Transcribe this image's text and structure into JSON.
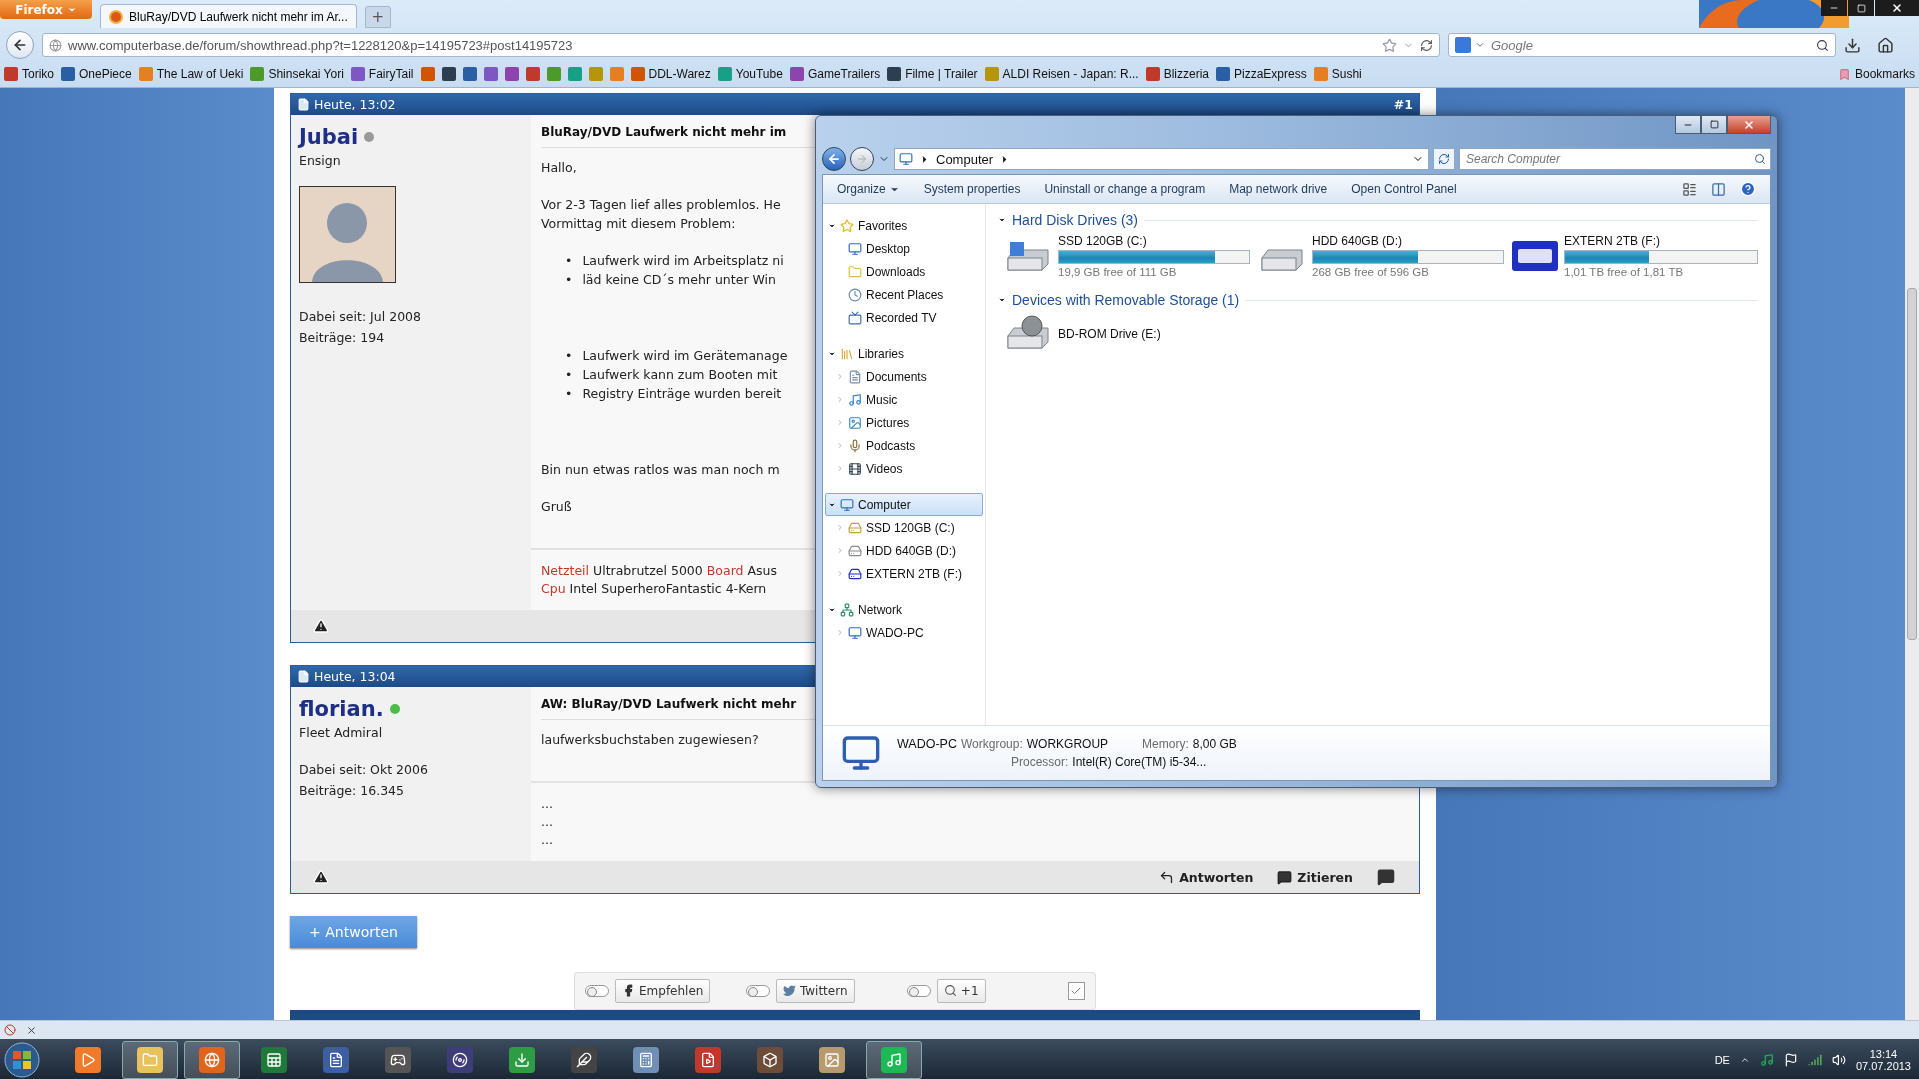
{
  "browser": {
    "menu_button": "Firefox",
    "tabs": [
      {
        "title": "BluRay/DVD Laufwerk nicht mehr im Ar...",
        "selected": true
      }
    ],
    "new_tab": "+",
    "url": "www.computerbase.de/forum/showthread.php?t=1228120&p=14195723#post14195723",
    "search_placeholder": "Google",
    "bookmarks": [
      {
        "kind": "link",
        "label": "Toriko"
      },
      {
        "kind": "link",
        "label": "OnePiece"
      },
      {
        "kind": "link",
        "label": "The Law of Ueki"
      },
      {
        "kind": "link",
        "label": "Shinsekai Yori"
      },
      {
        "kind": "link",
        "label": "FairyTail"
      },
      {
        "kind": "icon"
      },
      {
        "kind": "icon"
      },
      {
        "kind": "icon"
      },
      {
        "kind": "icon"
      },
      {
        "kind": "icon"
      },
      {
        "kind": "icon"
      },
      {
        "kind": "icon"
      },
      {
        "kind": "icon"
      },
      {
        "kind": "icon"
      },
      {
        "kind": "icon"
      },
      {
        "kind": "link",
        "label": "DDL-Warez"
      },
      {
        "kind": "link",
        "label": "YouTube"
      },
      {
        "kind": "link",
        "label": "GameTrailers"
      },
      {
        "kind": "link",
        "label": "Filme | Trailer"
      },
      {
        "kind": "link",
        "label": "ALDI Reisen - Japan: R..."
      },
      {
        "kind": "link",
        "label": "Blizzeria"
      },
      {
        "kind": "link",
        "label": "PizzaExpress"
      },
      {
        "kind": "link",
        "label": "Sushi"
      }
    ],
    "bookmarks_menu": "Bookmarks"
  },
  "posts": [
    {
      "date": "Heute, 13:02",
      "number": "#1",
      "user": "Jubai",
      "online": false,
      "rank": "Ensign",
      "avatar": true,
      "joined": "Dabei seit: Jul 2008",
      "count": "Beiträge: 194",
      "title": "BluRay/DVD Laufwerk nicht mehr im",
      "body": [
        {
          "kind": "paragraph",
          "lines": [
            "Hallo,"
          ]
        },
        {
          "kind": "paragraph",
          "lines": [
            "Vor 2-3 Tagen lief alles problemlos. He",
            "Vormittag mit diesem Problem:"
          ]
        },
        {
          "kind": "list",
          "marker": "•",
          "lines": [
            "Laufwerk wird im Arbeitsplatz ni",
            "läd keine CD´s mehr unter Win"
          ]
        },
        {
          "kind": "list",
          "marker": "•",
          "lines": [
            "Laufwerk wird im Gerätemanage",
            "Laufwerk kann zum Booten mit",
            "Registry Einträge wurden bereit"
          ]
        },
        {
          "kind": "paragraph",
          "lines": [
            "Bin nun etwas ratlos was man noch m"
          ]
        },
        {
          "kind": "paragraph",
          "lines": [
            "Gruß"
          ]
        }
      ],
      "signature": [
        [
          {
            "text": "Netzteil",
            "label": true
          },
          {
            "text": "Ultrabrutzel 5000",
            "label": false
          },
          {
            "text": "Board",
            "label": true
          },
          {
            "text": "Asus",
            "label": false
          }
        ],
        [
          {
            "text": "Cpu",
            "label": true
          },
          {
            "text": "Intel SuperheroFantastic 4-Kern",
            "label": false
          }
        ]
      ]
    },
    {
      "date": "Heute, 13:04",
      "user": "florian.",
      "online": true,
      "rank": "Fleet Admiral",
      "avatar": false,
      "joined": "Dabei seit: Okt 2006",
      "count": "Beiträge: 16.345",
      "title": "AW: BluRay/DVD Laufwerk nicht mehr",
      "body": [
        {
          "kind": "paragraph",
          "lines": [
            "laufwerksbuchstaben zugewiesen?"
          ]
        }
      ],
      "signature": [
        [
          {
            "text": "...",
            "label": false
          }
        ],
        [
          {
            "text": "...",
            "label": false
          }
        ],
        [
          {
            "text": "...",
            "label": false
          }
        ]
      ],
      "actions": [
        "Antworten",
        "Zitieren"
      ]
    }
  ],
  "reply_button": "+ Antworten",
  "share_settings": {
    "checked": true
  },
  "social": [
    {
      "label": "Empfehlen",
      "kind": "facebook",
      "on": false
    },
    {
      "label": "Twittern",
      "kind": "twitter",
      "on": false
    },
    {
      "label": "+1",
      "kind": "google",
      "on": false
    }
  ],
  "explorer": {
    "address": "Computer",
    "search_placeholder": "Search Computer",
    "commands": [
      {
        "label": "Organize",
        "menu": true
      },
      {
        "label": "System properties",
        "menu": false
      },
      {
        "label": "Uninstall or change a program",
        "menu": false
      },
      {
        "label": "Map network drive",
        "menu": false
      },
      {
        "label": "Open Control Panel",
        "menu": false
      }
    ],
    "tree": [
      {
        "label": "Favorites",
        "kind": "star",
        "selected": false,
        "children": [
          {
            "label": "Desktop",
            "kind": "desktop",
            "has_children": false
          },
          {
            "label": "Downloads",
            "kind": "downloads",
            "has_children": false
          },
          {
            "label": "Recent Places",
            "kind": "recent",
            "has_children": false
          },
          {
            "label": "Recorded TV",
            "kind": "tv",
            "has_children": false
          }
        ]
      },
      {
        "label": "Libraries",
        "kind": "library",
        "selected": false,
        "children": [
          {
            "label": "Documents",
            "kind": "documents",
            "has_children": true
          },
          {
            "label": "Music",
            "kind": "music",
            "has_children": true
          },
          {
            "label": "Pictures",
            "kind": "pictures",
            "has_children": true
          },
          {
            "label": "Podcasts",
            "kind": "podcasts",
            "has_children": true
          },
          {
            "label": "Videos",
            "kind": "videos",
            "has_children": true
          }
        ]
      },
      {
        "label": "Computer",
        "kind": "computer",
        "selected": true,
        "children": [
          {
            "label": "SSD 120GB (C:)",
            "kind": "ssd",
            "has_children": true
          },
          {
            "label": "HDD 640GB (D:)",
            "kind": "hdd",
            "has_children": true
          },
          {
            "label": "EXTERN 2TB (F:)",
            "kind": "wd",
            "has_children": true
          }
        ]
      },
      {
        "label": "Network",
        "kind": "network",
        "selected": false,
        "children": [
          {
            "label": "WADO-PC",
            "kind": "pc",
            "has_children": true
          }
        ]
      }
    ],
    "sections": [
      {
        "title": "Hard Disk Drives (3)",
        "items": [
          {
            "name": "SSD 120GB (C:)",
            "kind": "ssd",
            "level": 0.82,
            "free": "19,9 GB free of 111 GB"
          },
          {
            "name": "HDD 640GB (D:)",
            "kind": "hdd",
            "level": 0.55,
            "free": "268 GB free of 596 GB"
          },
          {
            "name": "EXTERN 2TB (F:)",
            "kind": "wd",
            "level": 0.44,
            "free": "1,01 TB free of 1,81 TB"
          }
        ]
      },
      {
        "title": "Devices with Removable Storage (1)",
        "items": [
          {
            "name": "BD-ROM Drive (E:)",
            "kind": "bd"
          }
        ]
      }
    ],
    "details": {
      "name": "WADO-PC",
      "fields": [
        {
          "label": "Workgroup:",
          "value": "WORKGROUP"
        },
        {
          "label": "Memory:",
          "value": "8,00 GB"
        },
        {
          "label": "Processor:",
          "value": "Intel(R) Core(TM) i5-34..."
        }
      ]
    }
  },
  "taskbar": {
    "language": "DE",
    "time": "13:14",
    "date": "07.07.2013"
  }
}
